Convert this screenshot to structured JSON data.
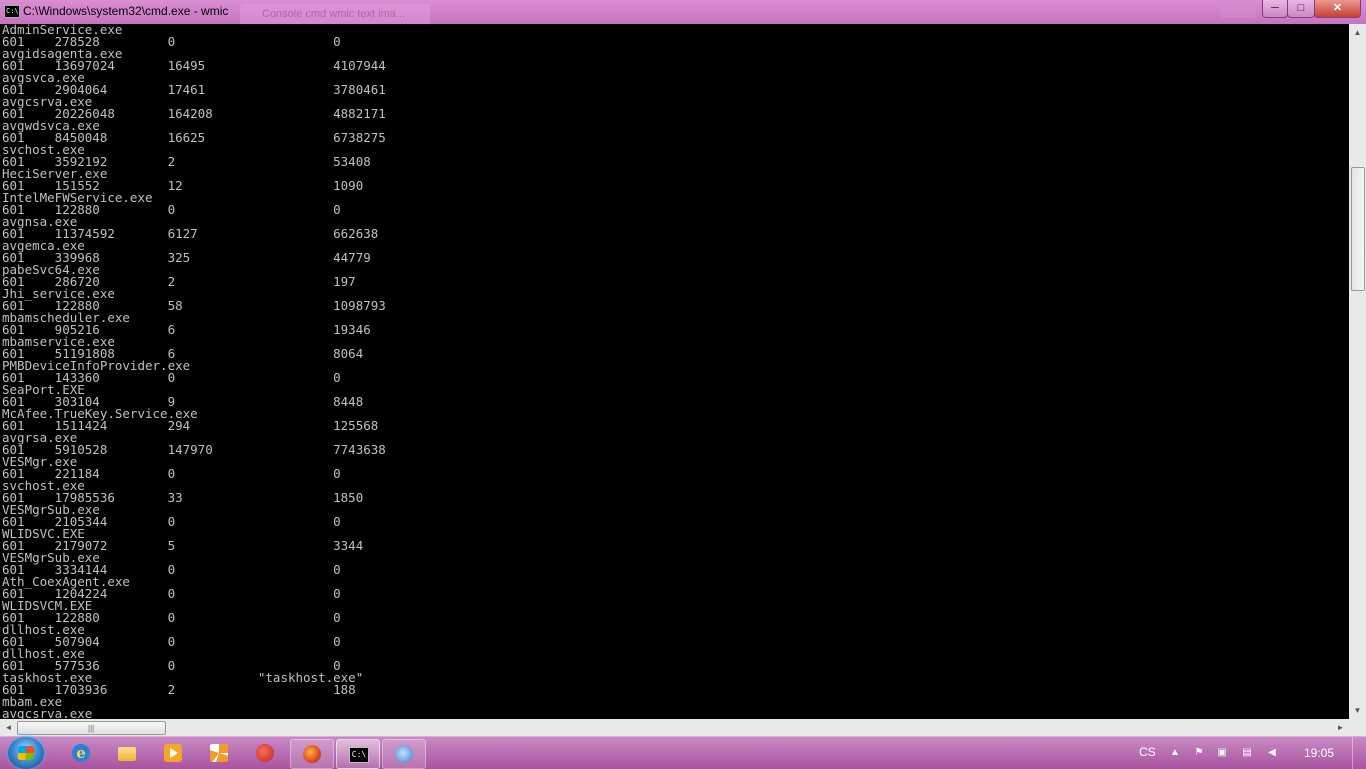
{
  "window": {
    "title": "C:\\Windows\\system32\\cmd.exe - wmic",
    "background_tab": "Console cmd wmic text ima...",
    "icon_label": "C:\\",
    "buttons": {
      "minimize": "─",
      "maximize": "□",
      "close": "✕"
    }
  },
  "console": {
    "lines": [
      "AdminService.exe",
      "601    278528         0                     0",
      "avgidsagenta.exe",
      "601    13697024       16495                 4107944",
      "avgsvca.exe",
      "601    2904064        17461                 3780461",
      "avgcsrva.exe",
      "601    20226048       164208                4882171",
      "avgwdsvca.exe",
      "601    8450048        16625                 6738275",
      "svchost.exe",
      "601    3592192        2                     53408",
      "HeciServer.exe",
      "601    151552         12                    1090",
      "IntelMeFWService.exe",
      "601    122880         0                     0",
      "avgnsa.exe",
      "601    11374592       6127                  662638",
      "avgemca.exe",
      "601    339968         325                   44779",
      "pabeSvc64.exe",
      "601    286720         2                     197",
      "Jhi_service.exe",
      "601    122880         58                    1098793",
      "mbamscheduler.exe",
      "601    905216         6                     19346",
      "mbamservice.exe",
      "601    51191808       6                     8064",
      "PMBDeviceInfoProvider.exe",
      "601    143360         0                     0",
      "SeaPort.EXE",
      "601    303104         9                     8448",
      "McAfee.TrueKey.Service.exe",
      "601    1511424        294                   125568",
      "avgrsa.exe",
      "601    5910528        147970                7743638",
      "VESMgr.exe",
      "601    221184         0                     0",
      "svchost.exe",
      "601    17985536       33                    1850",
      "VESMgrSub.exe",
      "601    2105344        0                     0",
      "WLIDSVC.EXE",
      "601    2179072        5                     3344",
      "VESMgrSub.exe",
      "601    3334144        0                     0",
      "Ath_CoexAgent.exe",
      "601    1204224        0                     0",
      "WLIDSVCM.EXE",
      "601    122880         0                     0",
      "dllhost.exe",
      "601    507904         0                     0",
      "dllhost.exe",
      "601    577536         0                     0",
      "taskhost.exe                      \"taskhost.exe\"",
      "601    1703936        2                     188",
      "mbam.exe",
      "avgcsrva.exe"
    ]
  },
  "scrollbars": {
    "up": "▲",
    "down": "▼",
    "left": "◄",
    "right": "►",
    "grip": "|||"
  },
  "taskbar": {
    "apps": [
      "Internet Explorer",
      "Windows Explorer",
      "Media Player",
      "Apps",
      "Paint",
      "Firefox",
      "Command Prompt",
      "Control Panel"
    ],
    "language": "CS",
    "tray": {
      "arrow": "▲",
      "flags": "⚑",
      "device": "▣",
      "network": "▤",
      "volume": "◀"
    },
    "clock": "19:05"
  },
  "colors": {
    "accent": "#c76fbf",
    "console_bg": "#000000",
    "console_fg": "#c0c0c0"
  }
}
